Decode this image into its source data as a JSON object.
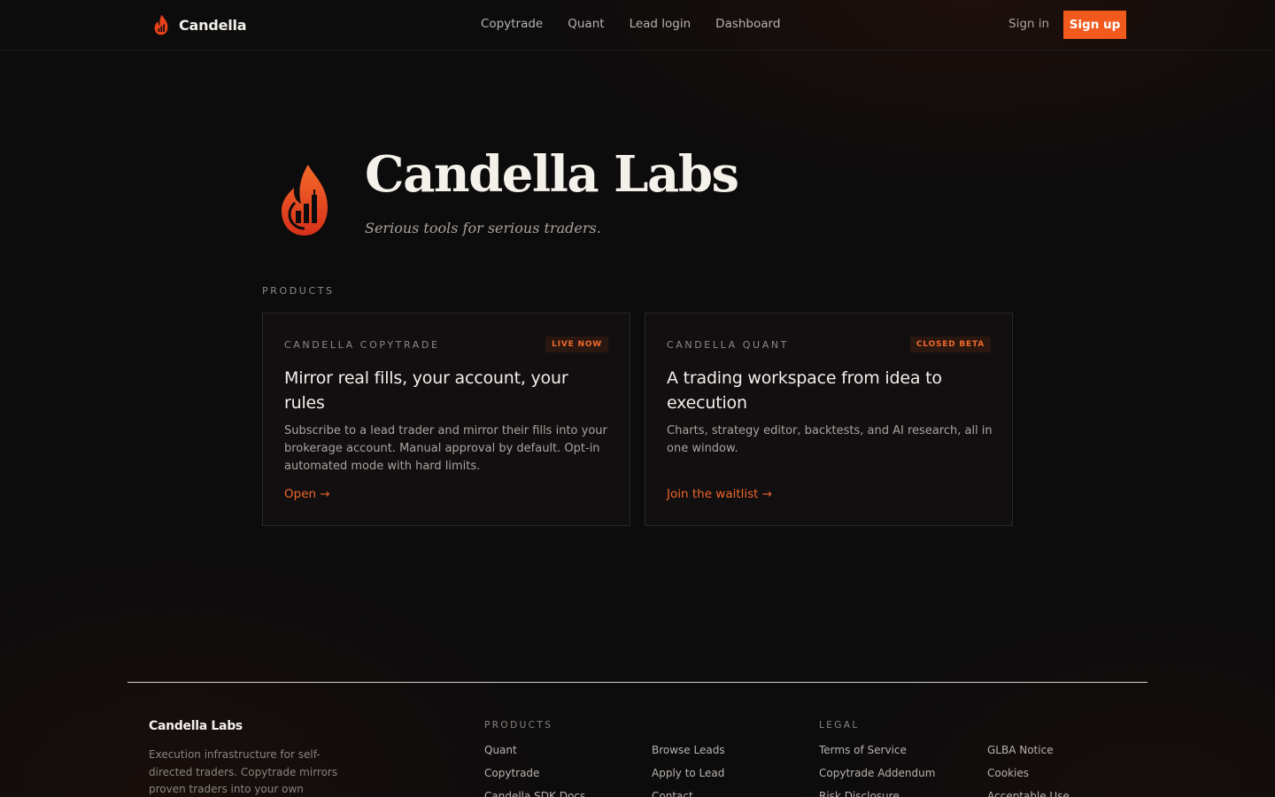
{
  "nav": {
    "brand": "Candella",
    "links": [
      "Copytrade",
      "Quant",
      "Lead login",
      "Dashboard"
    ],
    "signin": "Sign in",
    "signup": "Sign up"
  },
  "hero": {
    "title": "Candella Labs",
    "tagline": "Serious tools for serious traders."
  },
  "products_label": "PRODUCTS",
  "cards": [
    {
      "kicker": "CANDELLA COPYTRADE",
      "badge": "LIVE NOW",
      "title": "Mirror real fills, your account, your rules",
      "desc": "Subscribe to a lead trader and mirror their fills into your brokerage account. Manual approval by default. Opt-in automated mode with hard limits.",
      "link": "Open →"
    },
    {
      "kicker": "CANDELLA QUANT",
      "badge": "CLOSED BETA",
      "title": "A trading workspace from idea to execution",
      "desc": "Charts, strategy editor, backtests, and AI research, all in one window.",
      "link": "Join the waitlist →"
    }
  ],
  "footer": {
    "brand": "Candella Labs",
    "blurb": "Execution infrastructure for self-directed traders. Copytrade mirrors proven traders into your own brokerage;",
    "products_label": "PRODUCTS",
    "products_col1": [
      "Quant",
      "Copytrade",
      "Candella SDK Docs"
    ],
    "products_col2": [
      "Browse Leads",
      "Apply to Lead",
      "Contact"
    ],
    "legal_label": "LEGAL",
    "legal_col1": [
      "Terms of Service",
      "Copytrade Addendum",
      "Risk Disclosure"
    ],
    "legal_col2": [
      "GLBA Notice",
      "Cookies",
      "Acceptable Use"
    ]
  },
  "colors": {
    "accent": "#f15a1c",
    "background": "#0d0c0d"
  }
}
